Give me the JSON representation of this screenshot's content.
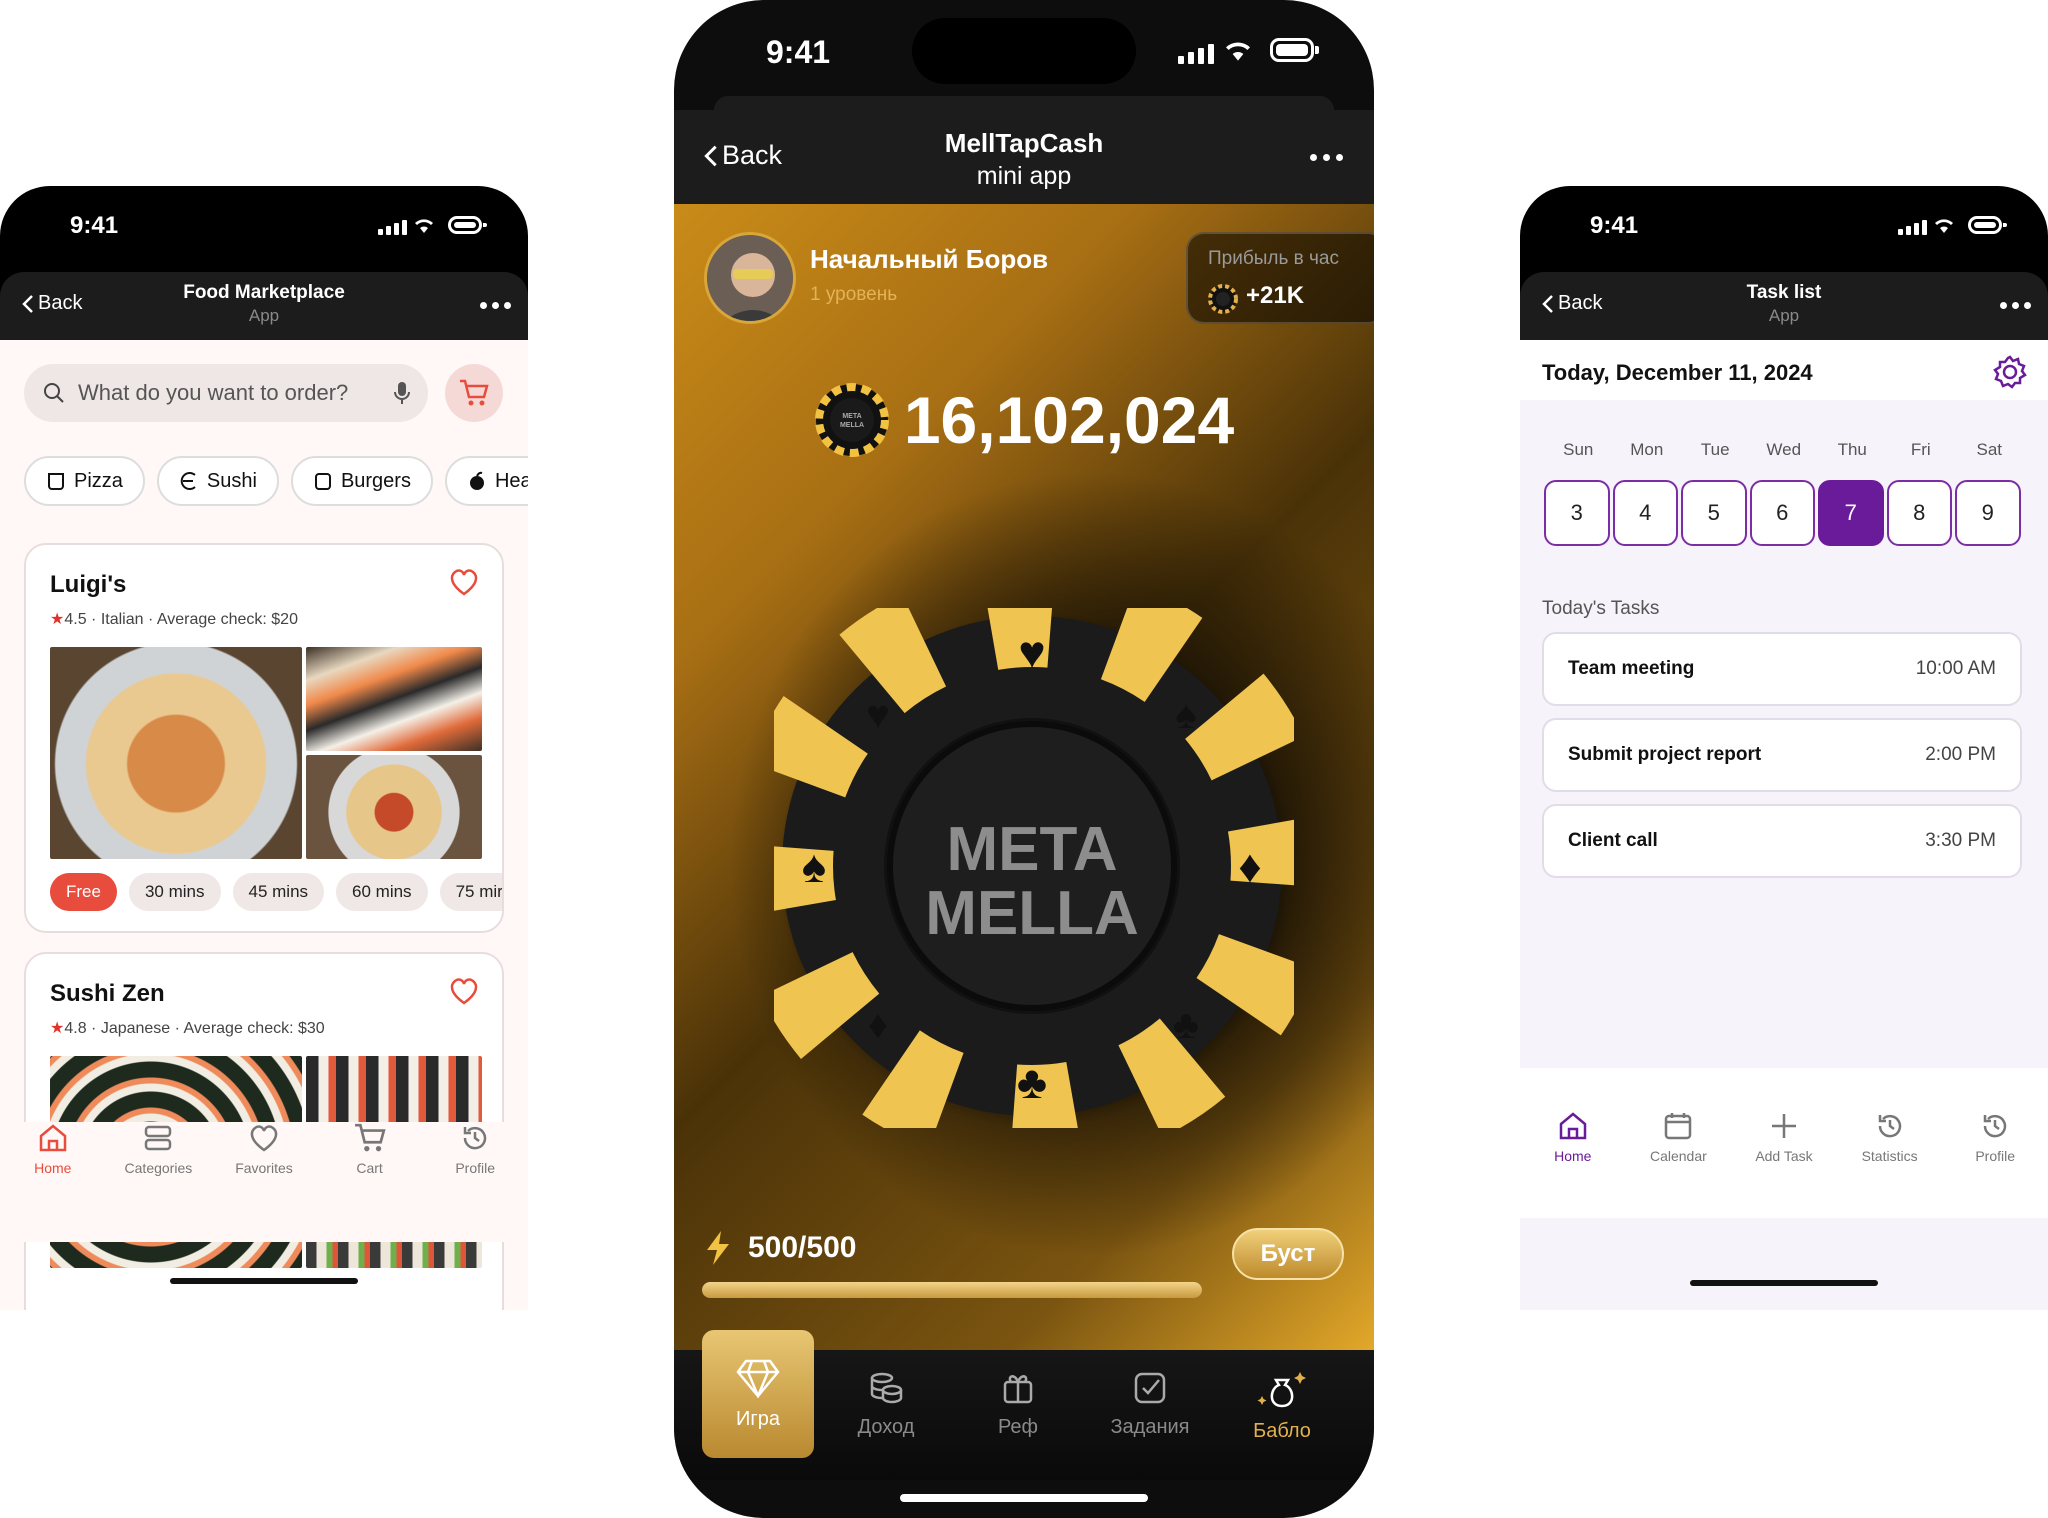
{
  "status": {
    "time": "9:41"
  },
  "food": {
    "header": {
      "back": "Back",
      "title": "Food Marketplace",
      "subtitle": "App"
    },
    "search": {
      "placeholder": "What do you want to order?"
    },
    "categories": [
      "Pizza",
      "Sushi",
      "Burgers",
      "Hea"
    ],
    "restaurants": [
      {
        "name": "Luigi's",
        "rating": "4.5",
        "meta": " · Italian · Average check: $20"
      },
      {
        "name": "Sushi Zen",
        "rating": "4.8",
        "meta": " · Japanese · Average check: $30"
      }
    ],
    "times": [
      "Free",
      "30 mins",
      "45 mins",
      "60 mins",
      "75 mir"
    ],
    "tabs": [
      "Home",
      "Categories",
      "Favorites",
      "Cart",
      "Profile"
    ],
    "accent": "#e74c3c"
  },
  "tap": {
    "header": {
      "back": "Back",
      "title": "MellTapCash",
      "subtitle": "mini app"
    },
    "user": {
      "name": "Начальный Боров",
      "level": "1 уровень"
    },
    "profit": {
      "label": "Прибыль в час",
      "value": "+21K"
    },
    "balance": "16,102,024",
    "chip_text": [
      "META",
      "MELLA"
    ],
    "coin_text": [
      "META",
      "MELLA"
    ],
    "energy": "500/500",
    "energy_fill": 1.0,
    "boost": "Буст",
    "nav": [
      "Игра",
      "Доход",
      "Реф",
      "Задания",
      "Бабло"
    ],
    "accent": "#d9a63a"
  },
  "task": {
    "header": {
      "back": "Back",
      "title": "Task list",
      "subtitle": "App"
    },
    "date": "Today, December 11, 2024",
    "weekdays": [
      "Sun",
      "Mon",
      "Tue",
      "Wed",
      "Thu",
      "Fri",
      "Sat"
    ],
    "days": [
      "3",
      "4",
      "5",
      "6",
      "7",
      "8",
      "9"
    ],
    "selected_day": "7",
    "section": "Today's Tasks",
    "tasks": [
      {
        "name": "Team meeting",
        "time": "10:00 AM"
      },
      {
        "name": "Submit project report",
        "time": "2:00 PM"
      },
      {
        "name": "Client call",
        "time": "3:30 PM"
      }
    ],
    "tabs": [
      "Home",
      "Calendar",
      "Add Task",
      "Statistics",
      "Profile"
    ],
    "accent": "#6a1b9a"
  }
}
